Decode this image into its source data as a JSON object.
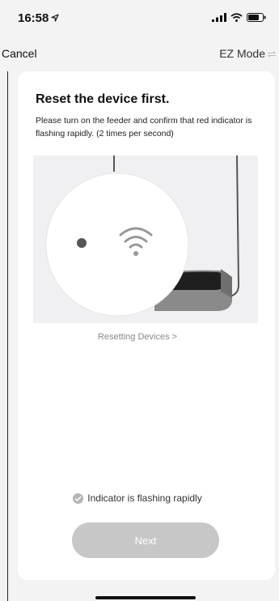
{
  "status_bar": {
    "time": "16:58",
    "location_icon": "location-arrow-icon",
    "signal_icon": "cellular-signal-icon",
    "wifi_icon": "wifi-icon",
    "battery_icon": "battery-icon"
  },
  "nav": {
    "cancel_label": "Cancel",
    "mode_label": "EZ Mode",
    "mode_icon": "switch-arrows-icon"
  },
  "card": {
    "title": "Reset the device first.",
    "description": "Please turn on the feeder and confirm that red indicator is flashing rapidly. (2 times per second)",
    "reset_link": "Resetting Devices >",
    "confirm_label": "Indicator is flashing rapidly",
    "next_label": "Next"
  },
  "colors": {
    "background": "#f3f3f3",
    "card": "#ffffff",
    "button_disabled": "#c7c7c7",
    "link": "#888888"
  }
}
